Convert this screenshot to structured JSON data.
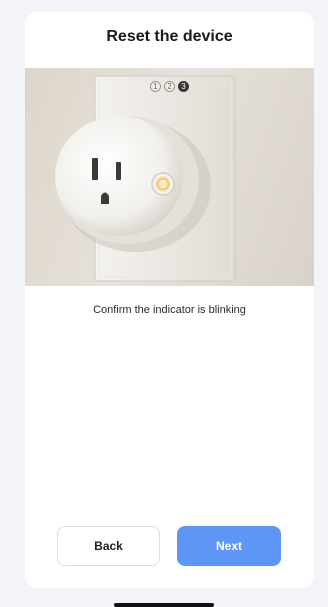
{
  "header": {
    "title": "Reset the device"
  },
  "stepper": {
    "steps": [
      "1",
      "2",
      "3"
    ],
    "current": 3
  },
  "illustration": {
    "icon": "smart-plug-image"
  },
  "instruction": {
    "text": "Confirm the indicator is blinking"
  },
  "actions": {
    "back_label": "Back",
    "next_label": "Next"
  },
  "colors": {
    "primary": "#5d96f4",
    "background": "#f3f4f8",
    "card": "#ffffff"
  }
}
